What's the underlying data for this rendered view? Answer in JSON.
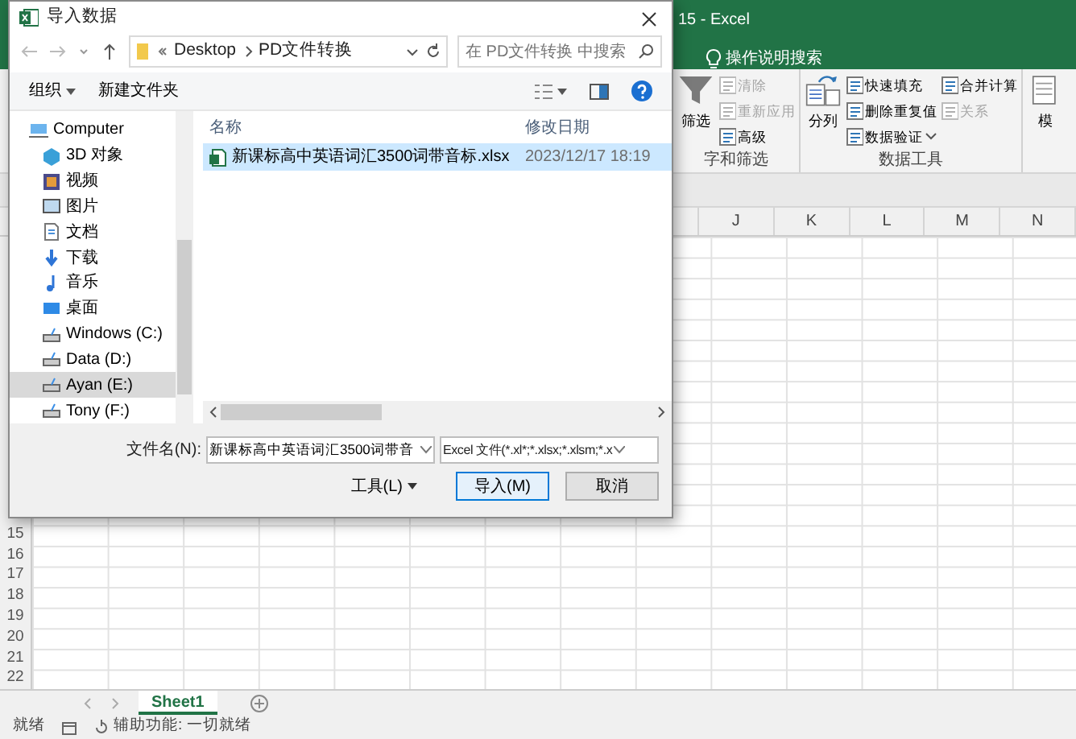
{
  "excel": {
    "title": "15 - Excel",
    "tell_me": "操作说明搜索",
    "ribbon_groups": [
      {
        "label": "字和筛选",
        "items": [
          {
            "kind": "large",
            "label": "筛选",
            "disabled": false
          },
          {
            "kind": "small",
            "label": "清除",
            "disabled": true,
            "dropdown": false
          },
          {
            "kind": "small",
            "label": "重新应用",
            "disabled": true,
            "dropdown": false
          },
          {
            "kind": "small",
            "label": "高级",
            "disabled": false,
            "dropdown": false
          }
        ]
      },
      {
        "label": "数据工具",
        "items": [
          {
            "kind": "large",
            "label": "分列",
            "disabled": false
          },
          {
            "kind": "small",
            "label": "快速填充",
            "disabled": false,
            "dropdown": false
          },
          {
            "kind": "small",
            "label": "删除重复值",
            "disabled": false,
            "dropdown": false
          },
          {
            "kind": "small",
            "label": "数据验证",
            "disabled": false,
            "dropdown": true
          },
          {
            "kind": "small",
            "label": "合并计算",
            "disabled": false,
            "dropdown": false
          },
          {
            "kind": "small",
            "label": "关系",
            "disabled": true,
            "dropdown": false
          }
        ]
      },
      {
        "items": [
          {
            "kind": "large",
            "label": "模",
            "disabled": false
          }
        ]
      }
    ],
    "columns": [
      "J",
      "K",
      "L",
      "M",
      "N"
    ],
    "row_numbers": [
      "15",
      "16",
      "17",
      "18",
      "19",
      "20",
      "21",
      "22"
    ],
    "sheet_tabs": [
      {
        "label": "Sheet1",
        "selected": true
      }
    ],
    "status_bar": {
      "ready": "就绪",
      "accessibility": "辅助功能: 一切就绪"
    }
  },
  "dialog": {
    "title": "导入数据",
    "address": [
      "Desktop",
      "PD文件转换"
    ],
    "search": {
      "placeholder": "在 PD文件转换 中搜索"
    },
    "toolbar": {
      "organize": "组织",
      "new_folder": "新建文件夹"
    },
    "sidebar": [
      {
        "label": "Computer",
        "selected": false,
        "children": [
          {
            "label": "3D 对象",
            "selected": false
          },
          {
            "label": "视频",
            "selected": false
          },
          {
            "label": "图片",
            "selected": false
          },
          {
            "label": "文档",
            "selected": false
          },
          {
            "label": "下载",
            "selected": false
          },
          {
            "label": "音乐",
            "selected": false
          },
          {
            "label": "桌面",
            "selected": false
          },
          {
            "label": "Windows (C:)",
            "selected": false
          },
          {
            "label": "Data (D:)",
            "selected": false
          },
          {
            "label": "Ayan (E:)",
            "selected": true
          },
          {
            "label": "Tony (F:)",
            "selected": false
          }
        ]
      }
    ],
    "file_columns": [
      "名称",
      "修改日期"
    ],
    "files": [
      {
        "name": "新课标高中英语词汇3500词带音标.xlsx",
        "modified": "2023/12/17 18:19",
        "selected": true
      }
    ],
    "filename_label": "文件名(N):",
    "filename": "新课标高中英语词汇3500词带音",
    "file_type": "Excel 文件(*.xl*;*.xlsx;*.xlsm;*.x",
    "tools": "工具(L)",
    "buttons": [
      {
        "label": "导入(M)",
        "kind": "primary"
      },
      {
        "label": "取消",
        "kind": "secondary"
      }
    ]
  }
}
